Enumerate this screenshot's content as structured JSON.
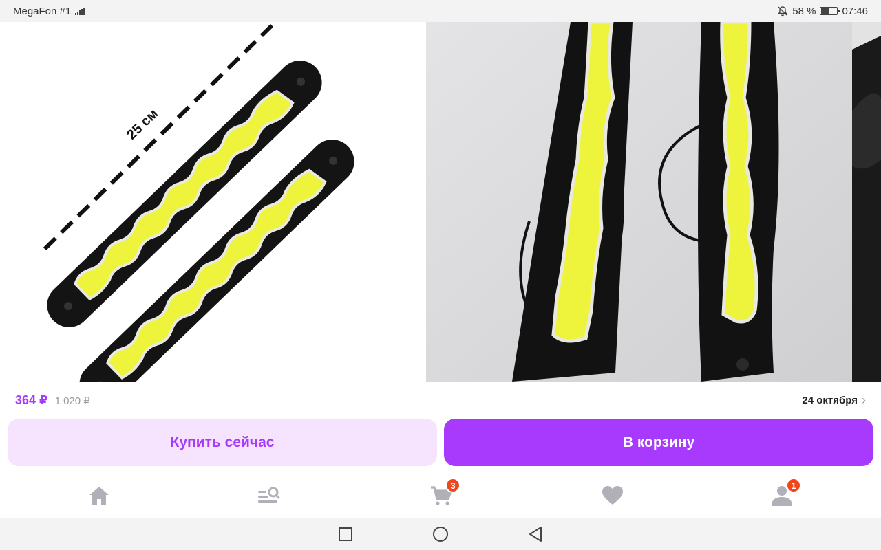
{
  "status_bar": {
    "carrier": "MegaFon #1",
    "battery": "58 %",
    "time": "07:46",
    "icons": [
      "signal-icon",
      "mute-bell-icon",
      "battery-icon"
    ]
  },
  "gallery": {
    "slides": [
      {
        "image": "led-strips-with-dimension",
        "caption": "25 см"
      },
      {
        "image": "led-strips-photo"
      },
      {
        "image": "partial-next-photo"
      }
    ]
  },
  "product": {
    "price": "364 ₽",
    "old_price": "1 020 ₽",
    "delivery_date": "24 октября"
  },
  "actions": {
    "buy_now": "Купить сейчас",
    "add_to_cart": "В корзину"
  },
  "tabbar": {
    "items": [
      {
        "name": "home",
        "icon": "home-icon"
      },
      {
        "name": "catalog",
        "icon": "catalog-search-icon"
      },
      {
        "name": "cart",
        "icon": "cart-icon",
        "badge": "3"
      },
      {
        "name": "favorites",
        "icon": "heart-icon"
      },
      {
        "name": "profile",
        "icon": "profile-icon",
        "badge": "1"
      }
    ]
  },
  "colors": {
    "accent": "#a73afd",
    "accent_light": "#f6e4fe",
    "badge": "#f0461e",
    "led_yellow": "#eef43c"
  },
  "system_nav": [
    "recents-square-icon",
    "home-circle-icon",
    "back-triangle-icon"
  ]
}
